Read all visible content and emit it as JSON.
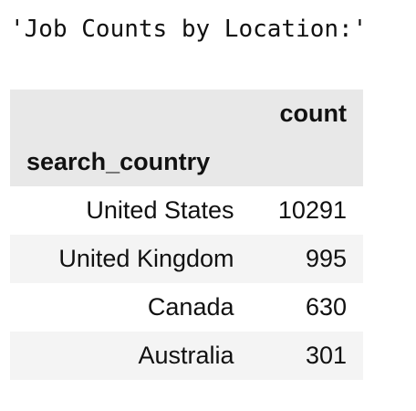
{
  "output_text": "'Job Counts by Location:'",
  "table": {
    "column_header": "count",
    "index_name": "search_country",
    "rows": [
      {
        "index": "United States",
        "count": "10291"
      },
      {
        "index": "United Kingdom",
        "count": "995"
      },
      {
        "index": "Canada",
        "count": "630"
      },
      {
        "index": "Australia",
        "count": "301"
      }
    ]
  }
}
